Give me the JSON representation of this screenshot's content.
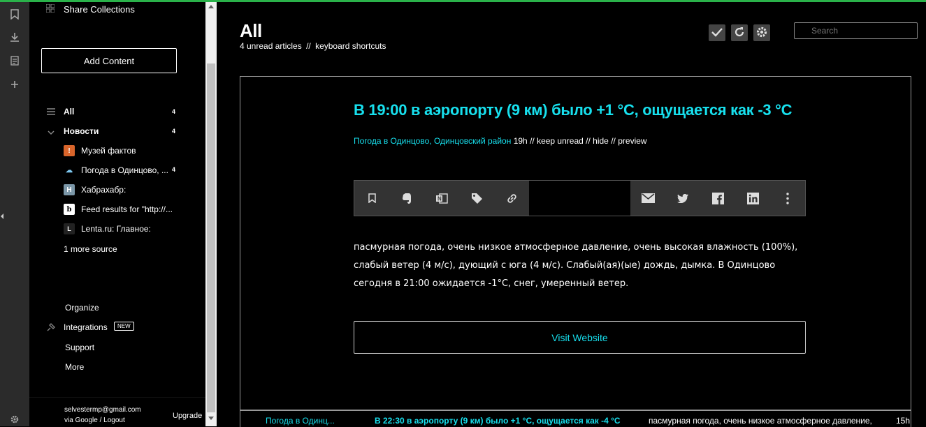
{
  "colors": {
    "accent": "#17e0ee",
    "topbar": "#2ab24a",
    "rail": "#2b2b2b"
  },
  "rail": {
    "icons": [
      "bookmark-icon",
      "download-icon",
      "list-icon",
      "plus-icon",
      "gear-icon"
    ]
  },
  "sidebar": {
    "share_collections": "Share Collections",
    "add_content": "Add Content",
    "nav": [
      {
        "label": "All",
        "count": "4"
      },
      {
        "label": "Новости",
        "count": "4"
      }
    ],
    "sources": [
      {
        "label": "Музей фактов",
        "count": "",
        "fav": "!"
      },
      {
        "label": "Погода в Одинцово, ...",
        "count": "4",
        "fav": "☁"
      },
      {
        "label": "Хабрахабр:",
        "count": "",
        "fav": "H"
      },
      {
        "label": "Feed results for \"http://...",
        "count": "",
        "fav": "b"
      },
      {
        "label": "Lenta.ru: Главное:",
        "count": "",
        "fav": "L"
      }
    ],
    "more_sources": "1 more source",
    "links": {
      "organize": "Organize",
      "integrations": "Integrations",
      "new_badge": "NEW",
      "support": "Support",
      "more": "More"
    },
    "footer": {
      "email": "selvestermp@gmail.com",
      "via": "via Google / Logout",
      "upgrade": "Upgrade"
    }
  },
  "main": {
    "title": "All",
    "unread": "4 unread articles",
    "sep": "//",
    "shortcuts": "keyboard shortcuts",
    "search_placeholder": "Search",
    "article": {
      "title": "В 19:00 в аэропорту (9 км) было +1 °C, ощущается как -3 °C",
      "source": "Погода в Одинцово, Одинцовский район",
      "age": "19h",
      "keep_unread": "keep unread",
      "hide": "hide",
      "preview": "preview",
      "body": "пасмурная погода, очень низкое атмосферное давление, очень высокая влажность (100%), слабый ветер (4 м/с), дующий с юга (4 м/с). Слабый(ая)(ые) дождь, дымка. В Одинцово сегодня в 21:00 ожидается -1°C, снег, умеренный ветер.",
      "visit": "Visit Website"
    },
    "next": {
      "source": "Погода в Одинц...",
      "title": "В 22:30 в аэропорту (9 км) было +1 °C, ощущается как -4 °C",
      "snippet": "пасмурная погода, очень низкое атмосферное давление,",
      "age": "15h"
    }
  }
}
